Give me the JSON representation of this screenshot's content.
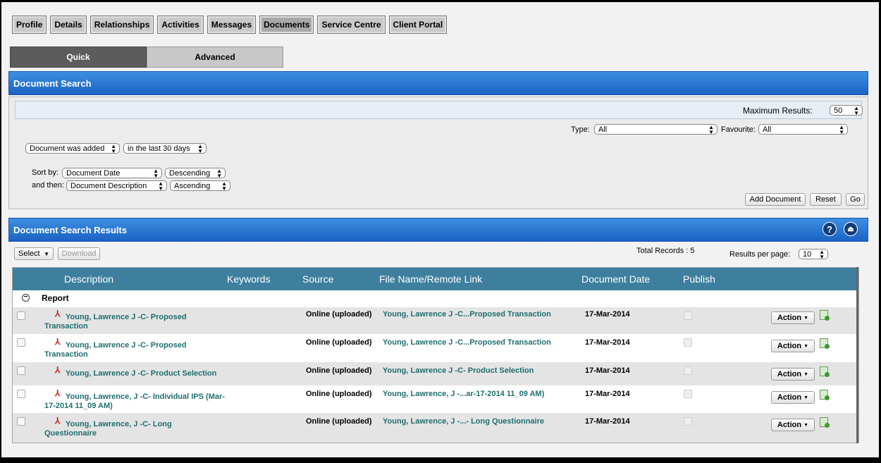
{
  "top_tabs": [
    "Profile",
    "Details",
    "Relationships",
    "Activities",
    "Messages",
    "Documents",
    "Service Centre",
    "Client Portal"
  ],
  "active_tab": "Documents",
  "sub_tabs": {
    "quick": "Quick",
    "advanced": "Advanced"
  },
  "search": {
    "title": "Document Search",
    "max_results_label": "Maximum Results:",
    "max_results_value": "50",
    "type_label": "Type:",
    "type_value": "All",
    "favourite_label": "Favourite:",
    "favourite_value": "All",
    "filter_field": "Document was added",
    "filter_range": "in the last 30 days",
    "sort_by_label": "Sort by:",
    "sort_by_field": "Document Date",
    "sort_by_order": "Descending",
    "then_label": "and then:",
    "then_field": "Document Description",
    "then_order": "Ascending",
    "add_button": "Add Document",
    "reset_button": "Reset",
    "go_button": "Go"
  },
  "results": {
    "title": "Document Search Results",
    "help_icon": "?",
    "select_label": "Select",
    "download_label": "Download",
    "total_records": "Total Records : 5",
    "per_page_label": "Results per page:",
    "per_page_value": "10",
    "columns": {
      "description": "Description",
      "keywords": "Keywords",
      "source": "Source",
      "file": "File Name/Remote Link",
      "date": "Document Date",
      "publish": "Publish"
    },
    "group": "Report",
    "action_label": "Action",
    "rows": [
      {
        "desc1": "Young, Lawrence J -C- Proposed",
        "desc2": "Transaction",
        "source": "Online (uploaded)",
        "file": "Young, Lawrence J -C...Proposed Transaction",
        "date": "17-Mar-2014"
      },
      {
        "desc1": "Young, Lawrence J -C- Proposed",
        "desc2": "Transaction",
        "source": "Online (uploaded)",
        "file": "Young, Lawrence J -C...Proposed Transaction",
        "date": "17-Mar-2014"
      },
      {
        "desc1": "Young, Lawrence J -C- Product Selection",
        "desc2": "",
        "source": "Online (uploaded)",
        "file": "Young, Lawrence J -C- Product Selection",
        "date": "17-Mar-2014"
      },
      {
        "desc1": "Young, Lawrence, J -C- Individual IPS (Mar-",
        "desc2": "17-2014 11_09 AM)",
        "source": "Online (uploaded)",
        "file": "Young, Lawrence, J -...ar-17-2014 11_09 AM)",
        "date": "17-Mar-2014"
      },
      {
        "desc1": "Young, Lawrence, J -C- Long",
        "desc2": "Questionnaire",
        "source": "Online (uploaded)",
        "file": "Young, Lawrence, J -...- Long Questionnaire",
        "date": "17-Mar-2014"
      }
    ]
  }
}
